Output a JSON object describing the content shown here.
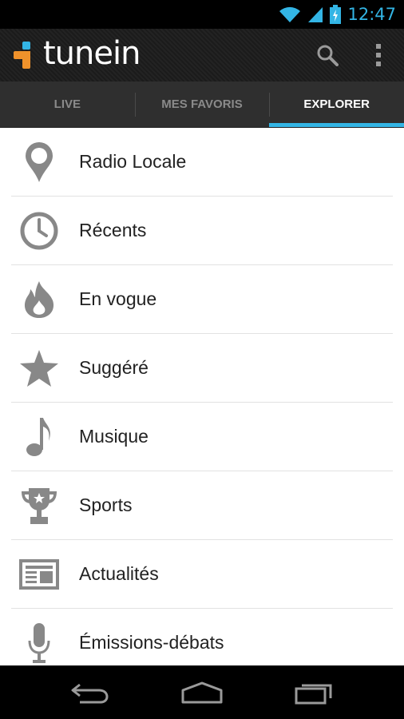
{
  "status_bar": {
    "time": "12:47",
    "icons": [
      "wifi-icon",
      "signal-icon",
      "battery-charging-icon"
    ],
    "accent_color": "#33b5e5"
  },
  "app": {
    "logo_text": "tunein",
    "logo_colors": [
      "#f0922b",
      "#33b5e5"
    ],
    "actions": [
      "search-icon",
      "overflow-menu-icon"
    ]
  },
  "tabs": [
    {
      "label": "LIVE",
      "active": false
    },
    {
      "label": "MES FAVORIS",
      "active": false
    },
    {
      "label": "EXPLORER",
      "active": true
    }
  ],
  "menu": {
    "items": [
      {
        "label": "Radio Locale",
        "icon": "map-pin-icon"
      },
      {
        "label": "Récents",
        "icon": "clock-icon"
      },
      {
        "label": "En vogue",
        "icon": "flame-icon"
      },
      {
        "label": "Suggéré",
        "icon": "star-icon"
      },
      {
        "label": "Musique",
        "icon": "music-note-icon"
      },
      {
        "label": "Sports",
        "icon": "trophy-icon"
      },
      {
        "label": "Actualités",
        "icon": "newspaper-icon"
      },
      {
        "label": "Émissions-débats",
        "icon": "microphone-icon"
      }
    ]
  },
  "nav_bar": {
    "buttons": [
      "back-icon",
      "home-icon",
      "recent-apps-icon"
    ]
  }
}
